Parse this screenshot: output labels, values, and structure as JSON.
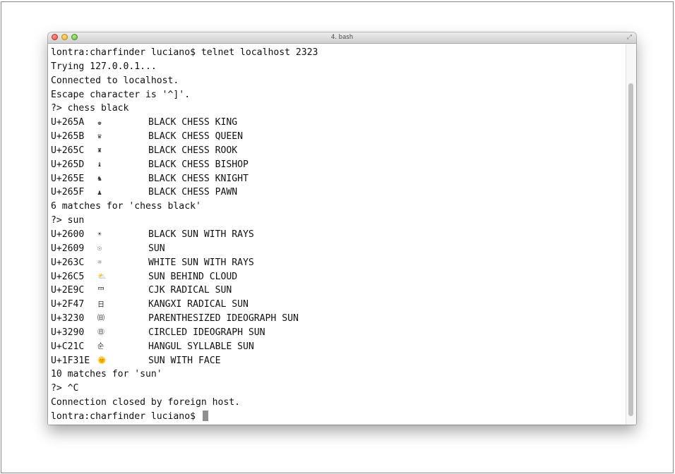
{
  "window": {
    "title": "4. bash",
    "fullscreen_icon": "fullscreen-icon"
  },
  "terminal": {
    "lines": [
      {
        "type": "text",
        "text": "lontra:charfinder luciano$ telnet localhost 2323"
      },
      {
        "type": "text",
        "text": "Trying 127.0.0.1..."
      },
      {
        "type": "text",
        "text": "Connected to localhost."
      },
      {
        "type": "text",
        "text": "Escape character is '^]'."
      },
      {
        "type": "text",
        "text": "?> chess black"
      },
      {
        "type": "row",
        "code": "U+265A",
        "glyph": "♚",
        "name": "BLACK CHESS KING"
      },
      {
        "type": "row",
        "code": "U+265B",
        "glyph": "♛",
        "name": "BLACK CHESS QUEEN"
      },
      {
        "type": "row",
        "code": "U+265C",
        "glyph": "♜",
        "name": "BLACK CHESS ROOK"
      },
      {
        "type": "row",
        "code": "U+265D",
        "glyph": "♝",
        "name": "BLACK CHESS BISHOP"
      },
      {
        "type": "row",
        "code": "U+265E",
        "glyph": "♞",
        "name": "BLACK CHESS KNIGHT"
      },
      {
        "type": "row",
        "code": "U+265F",
        "glyph": "♟",
        "name": "BLACK CHESS PAWN"
      },
      {
        "type": "text",
        "text": "6 matches for 'chess black'"
      },
      {
        "type": "text",
        "text": "?> sun"
      },
      {
        "type": "row",
        "code": "U+2600",
        "glyph": "☀",
        "name": "BLACK SUN WITH RAYS"
      },
      {
        "type": "row",
        "code": "U+2609",
        "glyph": "☉",
        "name": "SUN"
      },
      {
        "type": "row",
        "code": "U+263C",
        "glyph": "☼",
        "name": "WHITE SUN WITH RAYS"
      },
      {
        "type": "row",
        "code": "U+26C5",
        "glyph": "⛅",
        "name": "SUN BEHIND CLOUD",
        "tone": "cloud"
      },
      {
        "type": "row",
        "code": "U+2E9C",
        "glyph": "⺜",
        "name": "CJK RADICAL SUN"
      },
      {
        "type": "row",
        "code": "U+2F47",
        "glyph": "⽇",
        "name": "KANGXI RADICAL SUN"
      },
      {
        "type": "row",
        "code": "U+3230",
        "glyph": "㈰",
        "name": "PARENTHESIZED IDEOGRAPH SUN"
      },
      {
        "type": "row",
        "code": "U+3290",
        "glyph": "㊐",
        "name": "CIRCLED IDEOGRAPH SUN"
      },
      {
        "type": "row",
        "code": "U+C21C",
        "glyph": "순",
        "name": "HANGUL SYLLABLE SUN"
      },
      {
        "type": "row",
        "code": "U+1F31E",
        "glyph": "🌞",
        "name": "SUN WITH FACE",
        "tone": "warm"
      },
      {
        "type": "text",
        "text": "10 matches for 'sun'"
      },
      {
        "type": "text",
        "text": "?> ^C"
      },
      {
        "type": "text",
        "text": "Connection closed by foreign host."
      },
      {
        "type": "prompt",
        "text": "lontra:charfinder luciano$ "
      }
    ]
  }
}
